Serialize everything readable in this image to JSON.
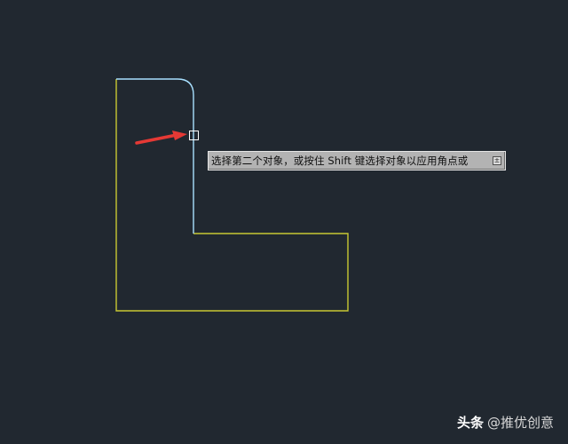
{
  "viewport": {
    "background": "#212830"
  },
  "drawing": {
    "outline_color": "#c8c832",
    "selected_edge_color": "#a8e0ff",
    "arrow_color": "#e53935",
    "pickbox_color": "#ffffff"
  },
  "tooltip": {
    "text": "选择第二个对象，或按住 Shift 键选择对象以应用角点或",
    "expand_symbol": "±"
  },
  "watermark": {
    "brand": "头条",
    "handle": "@推优创意"
  }
}
